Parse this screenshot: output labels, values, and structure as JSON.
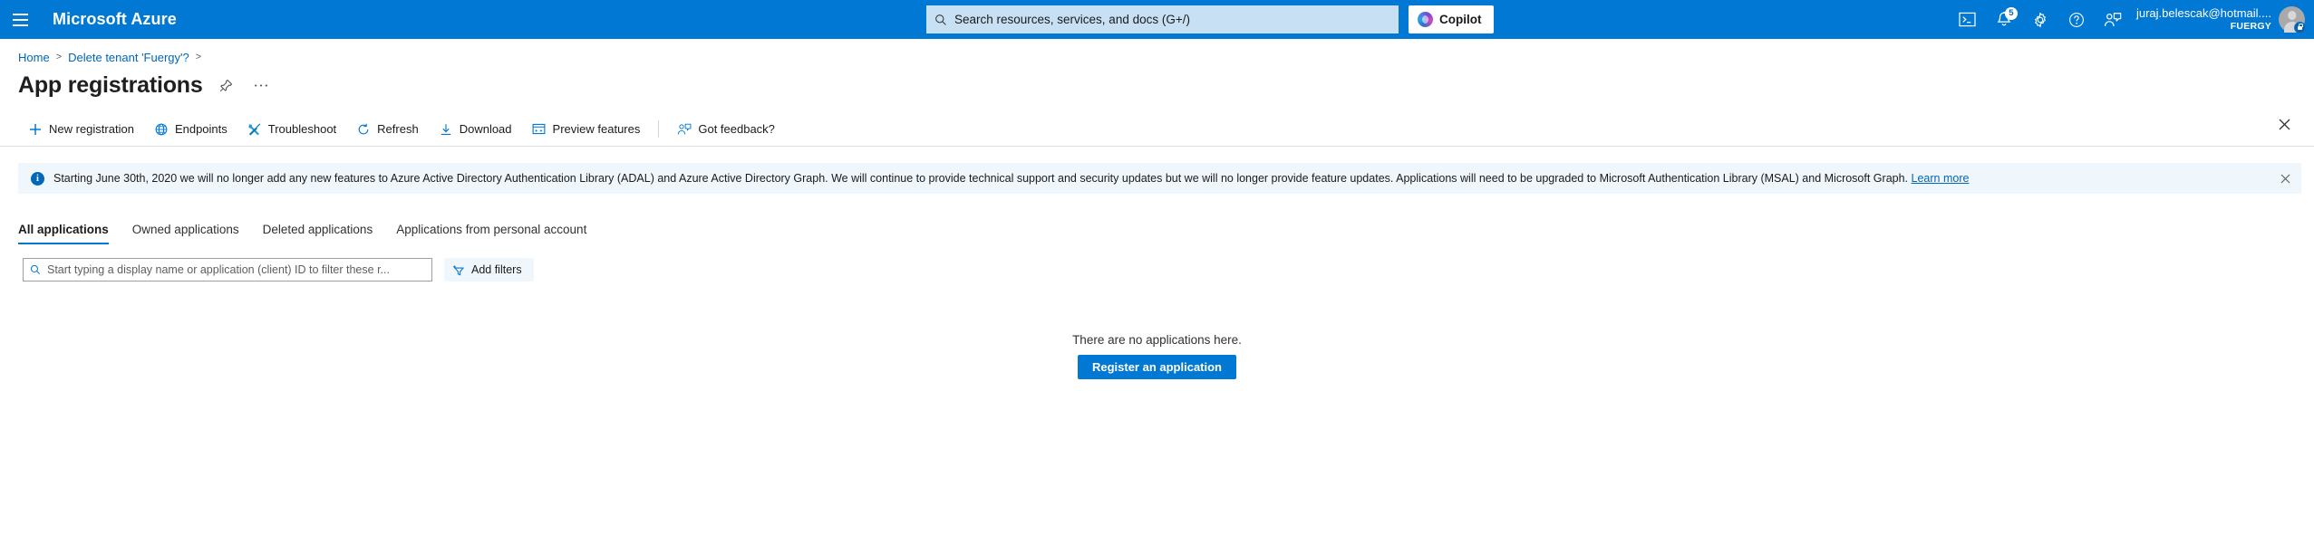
{
  "header": {
    "menu_icon": "hamburger-icon",
    "brand": "Microsoft Azure",
    "search": {
      "placeholder": "Search resources, services, and docs (G+/)",
      "icon": "search-icon"
    },
    "copilot": {
      "label": "Copilot",
      "icon": "copilot-icon"
    },
    "icons": [
      {
        "name": "cloud-shell-icon",
        "glyph": ">_"
      },
      {
        "name": "notifications-icon",
        "badge": "5"
      },
      {
        "name": "settings-gear-icon"
      },
      {
        "name": "help-icon",
        "glyph": "?"
      },
      {
        "name": "feedback-icon"
      }
    ],
    "account": {
      "name": "juraj.belescak@hotmail....",
      "org": "FUERGY",
      "avatar": "user-avatar-locked"
    },
    "accent_color": "#0078d4",
    "search_bg": "#c7e0f4"
  },
  "breadcrumb": {
    "items": [
      {
        "label": "Home"
      },
      {
        "label": "Delete tenant 'Fuergy'?"
      }
    ],
    "separator": ">"
  },
  "page": {
    "title": "App registrations",
    "pin_icon": "pin-icon",
    "more_icon": "ellipsis-icon",
    "close_icon": "close-icon"
  },
  "toolbar": {
    "items": [
      {
        "label": "New registration",
        "icon": "plus-icon"
      },
      {
        "label": "Endpoints",
        "icon": "globe-icon"
      },
      {
        "label": "Troubleshoot",
        "icon": "wrench-icon"
      },
      {
        "label": "Refresh",
        "icon": "refresh-icon"
      },
      {
        "label": "Download",
        "icon": "download-icon"
      },
      {
        "label": "Preview features",
        "icon": "preview-features-icon"
      },
      {
        "label": "Got feedback?",
        "icon": "feedback-icon"
      }
    ]
  },
  "banner": {
    "icon": "info-icon",
    "text": "Starting June 30th, 2020 we will no longer add any new features to Azure Active Directory Authentication Library (ADAL) and Azure Active Directory Graph. We will continue to provide technical support and security updates but we will no longer provide feature updates. Applications will need to be upgraded to Microsoft Authentication Library (MSAL) and Microsoft Graph.",
    "link_label": "Learn more",
    "close_icon": "close-icon",
    "bg_color": "#eff6fc"
  },
  "tabs": [
    {
      "label": "All applications",
      "active": true
    },
    {
      "label": "Owned applications",
      "active": false
    },
    {
      "label": "Deleted applications",
      "active": false
    },
    {
      "label": "Applications from personal account",
      "active": false
    }
  ],
  "filters": {
    "search_placeholder": "Start typing a display name or application (client) ID to filter these r...",
    "search_value": "",
    "search_icon": "search-icon",
    "add_filters_label": "Add filters",
    "add_filters_icon": "add-filter-icon"
  },
  "empty_state": {
    "message": "There are no applications here.",
    "button_label": "Register an application"
  }
}
